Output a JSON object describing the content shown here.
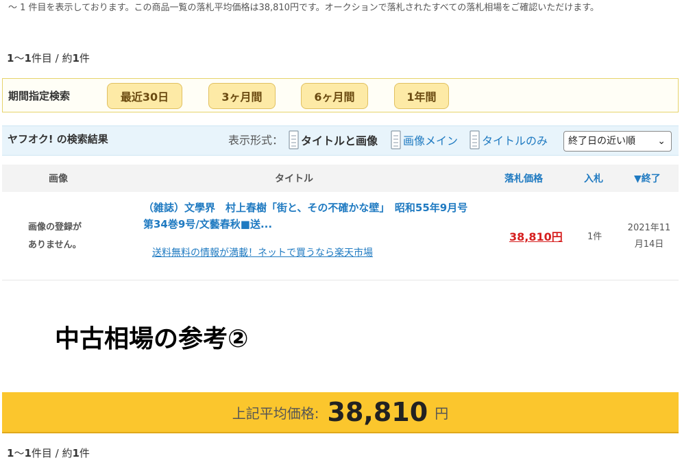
{
  "intro_text": "～ 1 件目を表示しております。この商品一覧の落札平均価格は38,810円です。オークションで落札されたすべての落札相場をご確認いただけます。",
  "count_top": {
    "start": "1",
    "sep": "〜",
    "end": "1",
    "mid": "件目 / 約",
    "total": "1",
    "suffix": "件"
  },
  "count_bottom": {
    "start": "1",
    "sep": "〜",
    "end": "1",
    "mid": "件目 / 約",
    "total": "1",
    "suffix": "件"
  },
  "period": {
    "label": "期間指定検索",
    "buttons": [
      "最近30日",
      "3ヶ月間",
      "6ヶ月間",
      "1年間"
    ]
  },
  "results": {
    "title": "ヤフオク! の検索結果",
    "view_label": "表示形式：",
    "view_options": [
      "タイトルと画像",
      "画像メイン",
      "タイトルのみ"
    ],
    "sort_selected": "終了日の近い順"
  },
  "table": {
    "headers": {
      "image": "画像",
      "title": "タイトル",
      "price": "落札価格",
      "bids": "入札",
      "end": "▼終了"
    }
  },
  "item": {
    "no_image": "画像の登録が\nありません。",
    "title": "（雑誌）文學界　村上春樹「街と、その不確かな壁」　昭和55年9月号　第34巻9号/文藝春秋■送...",
    "ad_link": "送料無料の情報が満載！ネットで買うなら楽天市場",
    "price": "38,810円",
    "bids": "1件",
    "end_date": "2021年11月14日"
  },
  "section_heading": "中古相場の参考②",
  "average": {
    "label": "上記平均価格:",
    "value": "38,810",
    "unit": "円"
  },
  "colors": {
    "accent_blue": "#1f7ac1",
    "price_red": "#d61f1f",
    "avg_bar": "#fbc62d",
    "period_btn": "#fdeaa6"
  },
  "icons": [
    "document-icon"
  ]
}
